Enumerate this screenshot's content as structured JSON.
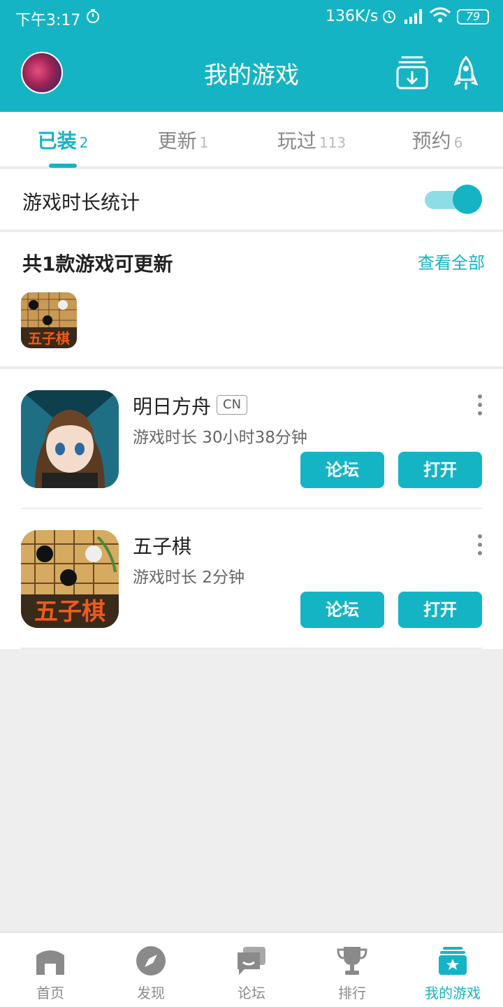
{
  "status_bar": {
    "time": "下午3:17",
    "speed": "136K/s",
    "battery": "79"
  },
  "header": {
    "title": "我的游戏",
    "icons": [
      "avatar",
      "download-manager-icon",
      "rocket-icon"
    ]
  },
  "tabs": [
    {
      "label": "已装",
      "count": "2",
      "active": true
    },
    {
      "label": "更新",
      "count": "1",
      "active": false
    },
    {
      "label": "玩过",
      "count": "113",
      "active": false
    },
    {
      "label": "预约",
      "count": "6",
      "active": false
    }
  ],
  "playtime_stats": {
    "label": "游戏时长统计",
    "enabled": true
  },
  "updates": {
    "title": "共1款游戏可更新",
    "view_all": "查看全部",
    "icon_text": "五子棋"
  },
  "games": [
    {
      "name": "明日方舟",
      "tag": "CN",
      "play_time": "游戏时长 30小时38分钟",
      "forum_label": "论坛",
      "open_label": "打开"
    },
    {
      "name": "五子棋",
      "tag": "",
      "play_time": "游戏时长 2分钟",
      "forum_label": "论坛",
      "open_label": "打开",
      "icon_text": "五子棋"
    }
  ],
  "bottom_nav": [
    {
      "label": "首页",
      "icon": "home-icon",
      "active": false
    },
    {
      "label": "发现",
      "icon": "compass-icon",
      "active": false
    },
    {
      "label": "论坛",
      "icon": "chat-icon",
      "active": false
    },
    {
      "label": "排行",
      "icon": "trophy-icon",
      "active": false
    },
    {
      "label": "我的游戏",
      "icon": "my-games-icon",
      "active": true
    }
  ],
  "colors": {
    "accent": "#15b4c4",
    "background": "#eeeeee"
  }
}
